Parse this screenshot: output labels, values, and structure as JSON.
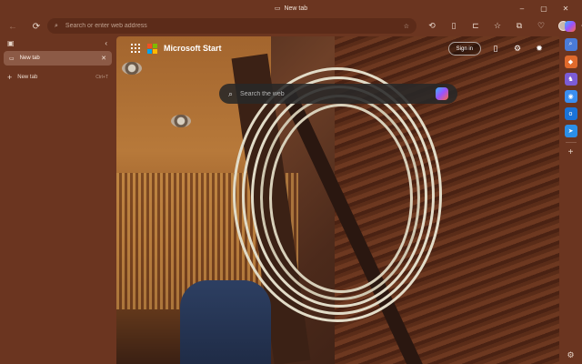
{
  "window": {
    "title": "New tab",
    "controls": {
      "minimize": "–",
      "maximize": "▢",
      "close": "✕"
    }
  },
  "toolbar": {
    "address_placeholder": "Search or enter web address"
  },
  "tabs_panel": {
    "tabs": [
      {
        "label": "New tab"
      }
    ],
    "new_tab_label": "New tab",
    "new_tab_shortcut": "Ctrl+T"
  },
  "content": {
    "brand": "Microsoft Start",
    "signin_label": "Sign in",
    "search_placeholder": "Search the web"
  },
  "sidebar": {
    "apps": [
      {
        "icon": "search-icon",
        "color": "#4a7bd8"
      },
      {
        "icon": "shopping-icon",
        "color": "#e06a2c"
      },
      {
        "icon": "games-icon",
        "color": "#7c5cd6"
      },
      {
        "icon": "copilot-icon",
        "color": "#3a8ef0"
      },
      {
        "icon": "outlook-icon",
        "color": "#1a73d9"
      },
      {
        "icon": "send-icon",
        "color": "#2b8fe8"
      }
    ]
  },
  "colors": {
    "chrome_bg": "#6b3520",
    "address_bg": "#5c2b19",
    "active_tab": "#8c5a46"
  }
}
